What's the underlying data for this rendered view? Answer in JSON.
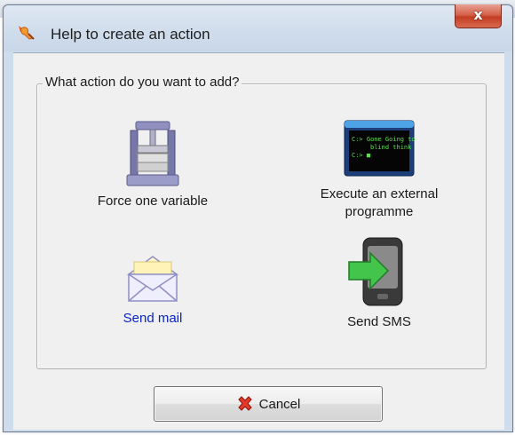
{
  "dialog": {
    "title": "Help to create an action",
    "close_symbol": "x"
  },
  "group": {
    "legend": "What action do you want to add?"
  },
  "actions": [
    {
      "label": "Force one variable",
      "icon": "press-icon"
    },
    {
      "label": "Execute an external programme",
      "icon": "terminal-icon"
    },
    {
      "label": "Send mail",
      "icon": "envelope-icon",
      "color": "#0b24c4"
    },
    {
      "label": "Send SMS",
      "icon": "phone-arrow-icon"
    }
  ],
  "terminal": {
    "lines": [
      "C:> Gone Going to",
      "blind think",
      "C:> ■"
    ]
  },
  "buttons": {
    "cancel_label": "Cancel"
  },
  "colors": {
    "link": "#0b24c4",
    "close_button": "#c23d22",
    "title_gradient": "#cfdceb"
  }
}
